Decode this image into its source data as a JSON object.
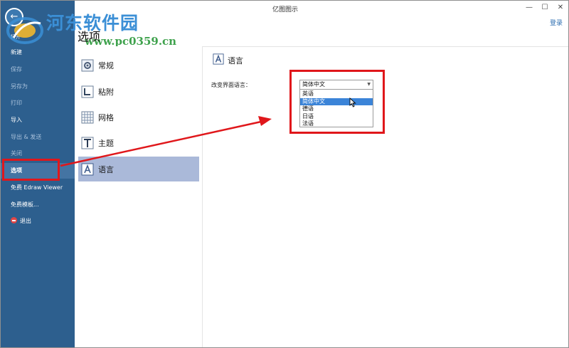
{
  "window": {
    "title": "亿图图示",
    "minimize_glyph": "—",
    "maximize_glyph": "☐",
    "close_glyph": "✕",
    "login_label": "登录"
  },
  "sidebar": {
    "back_glyph": "←",
    "open_label": "打开",
    "items": [
      {
        "label": "新建"
      },
      {
        "label": "保存"
      },
      {
        "label": "另存为"
      },
      {
        "label": "打印"
      },
      {
        "label": "导入"
      },
      {
        "label": "导出 & 发送"
      },
      {
        "label": "关闭"
      },
      {
        "label": "选项"
      },
      {
        "label": "免费 Edraw Viewer"
      },
      {
        "label": "免费模板..."
      },
      {
        "label": "退出"
      }
    ]
  },
  "watermark": {
    "name": "河东软件园",
    "url": "www.pc0359.cn"
  },
  "options": {
    "title": "选项",
    "categories": [
      {
        "label": "常规",
        "icon": "gear-icon"
      },
      {
        "label": "粘附",
        "icon": "snap-icon"
      },
      {
        "label": "网格",
        "icon": "grid-icon"
      },
      {
        "label": "主题",
        "icon": "theme-icon"
      },
      {
        "label": "语言",
        "icon": "language-icon"
      }
    ],
    "active_category": "语言"
  },
  "language": {
    "header": "语言",
    "field_label": "改变界面语言：",
    "selected": "简体中文",
    "options": [
      "英语",
      "简体中文",
      "德语",
      "日语",
      "法语"
    ],
    "highlighted": "简体中文"
  },
  "colors": {
    "sidebar_bg": "#2d5f8e",
    "active_category_bg": "#aab9d9",
    "option_highlight": "#3b84d8",
    "annotation_red": "#e0171b"
  }
}
